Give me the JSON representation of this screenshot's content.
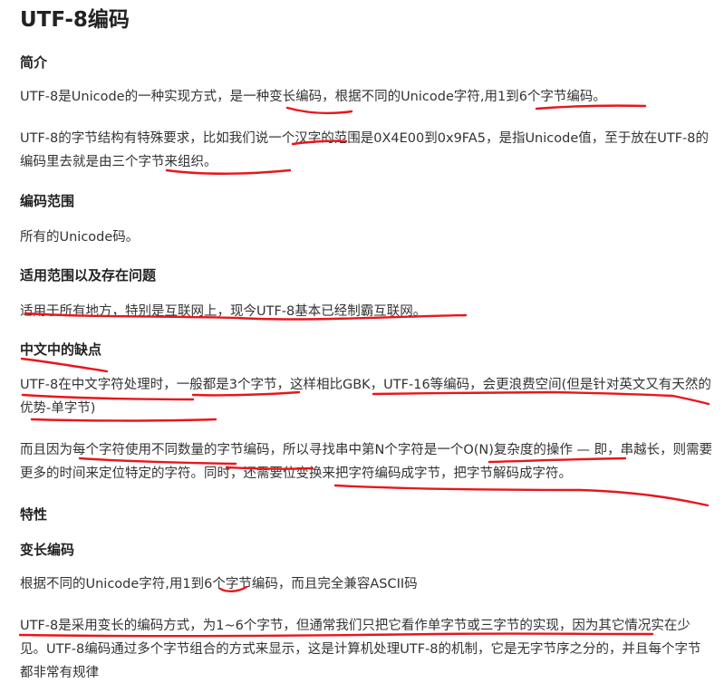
{
  "title": "UTF-8编码",
  "sections": {
    "intro": {
      "heading": "简介",
      "p1": "UTF-8是Unicode的一种实现方式，是一种变长编码，根据不同的Unicode字符,用1到6个字节编码。",
      "p2": "UTF-8的字节结构有特殊要求，比如我们说一个汉字的范围是0X4E00到0x9FA5，是指Unicode值，至于放在UTF-8的编码里去就是由三个字节来组织。"
    },
    "range": {
      "heading": "编码范围",
      "p1": "所有的Unicode码。"
    },
    "scope": {
      "heading": "适用范围以及存在问题",
      "p1": "适用于所有地方，特别是互联网上，现今UTF-8基本已经制霸互联网。"
    },
    "cons": {
      "heading": "中文中的缺点",
      "p1": "UTF-8在中文字符处理时，一般都是3个字节，这样相比GBK，UTF-16等编码，会更浪费空间(但是针对英文又有天然的优势-单字节)",
      "p2": "而且因为每个字符使用不同数量的字节编码，所以寻找串中第N个字符是一个O(N)复杂度的操作 — 即，串越长，则需要更多的时间来定位特定的字符。同时，还需要位变换来把字符编码成字节，把字节解码成字符。"
    },
    "features": {
      "heading": "特性",
      "subheading": "变长编码",
      "p1": "根据不同的Unicode字符,用1到6个字节编码，而且完全兼容ASCII码",
      "p2": "UTF-8是采用变长的编码方式，为1~6个字节，但通常我们只把它看作单字节或三字节的实现，因为其它情况实在少见。UTF-8编码通过多个字节组合的方式来显示，这是计算机处理UTF-8的机制，它是无字节序之分的，并且每个字节都非常有规律"
    }
  }
}
